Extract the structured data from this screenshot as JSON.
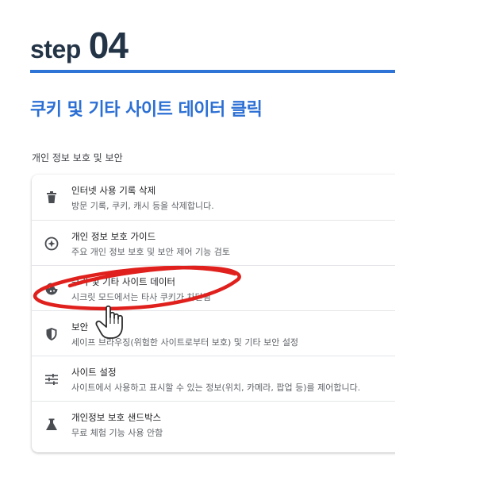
{
  "header": {
    "step_word": "step",
    "step_number": "04",
    "subtitle": "쿠키 및 기타 사이트 데이터 클릭"
  },
  "section": {
    "title": "개인 정보 보호 및 보안"
  },
  "items": [
    {
      "icon": "trash-icon",
      "label": "인터넷 사용 기록 삭제",
      "desc": "방문 기록, 쿠키, 캐시 등을 삭제합니다."
    },
    {
      "icon": "compass-plus-icon",
      "label": "개인 정보 보호 가이드",
      "desc": "주요 개인 정보 보호 및 보안 제어 기능 검토"
    },
    {
      "icon": "cookie-icon",
      "label": "쿠키 및 기타 사이트 데이터",
      "desc": "시크릿 모드에서는 타사 쿠키가 차단됨"
    },
    {
      "icon": "shield-icon",
      "label": "보안",
      "desc": "세이프 브라우징(위험한 사이트로부터 보호) 및 기타 보안 설정"
    },
    {
      "icon": "sliders-icon",
      "label": "사이트 설정",
      "desc": "사이트에서 사용하고 표시할 수 있는 정보(위치, 카메라, 팝업 등)를 제어합니다."
    },
    {
      "icon": "flask-icon",
      "label": "개인정보 보호 샌드박스",
      "desc": "무료 체험 기능 사용 안함"
    }
  ],
  "colors": {
    "accent": "#2e74d6",
    "heading": "#243447",
    "annotation": "#e0201c"
  }
}
